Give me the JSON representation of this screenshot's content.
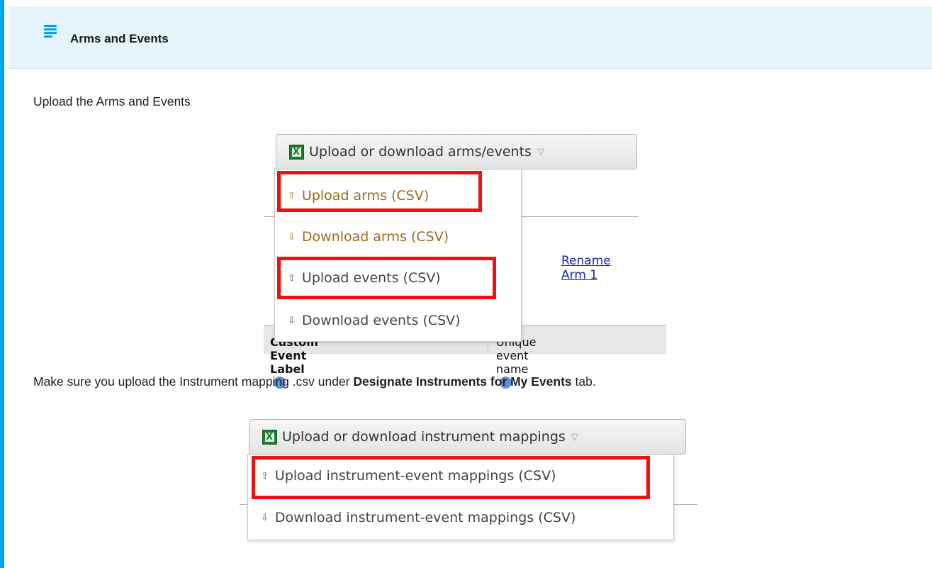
{
  "admonition": {
    "title": "Arms and Events",
    "icon": "list-icon",
    "accent_color": "#00a6e6"
  },
  "paragraph1": "Upload the Arms and Events",
  "paragraph2": {
    "before": "Make sure you upload the Instrument mapping .csv under ",
    "bold": "Designate Instruments for My Events",
    "after": " tab."
  },
  "screenshot1": {
    "button_label": "Upload or download arms/events",
    "items": [
      {
        "label": "Upload arms (CSV)",
        "icon": "up-arrow-icon",
        "highlighted": true
      },
      {
        "label": "Download arms (CSV)",
        "icon": "down-arrow-icon",
        "highlighted": false
      },
      {
        "label": "Upload events (CSV)",
        "icon": "up-arrow-icon",
        "highlighted": true
      },
      {
        "label": "Download events (CSV)",
        "icon": "down-arrow-icon",
        "highlighted": false
      }
    ],
    "link": "Rename Arm 1",
    "column1": "Custom Event Label",
    "column2": "Unique event name"
  },
  "screenshot2": {
    "button_label": "Upload or download instrument mappings",
    "items": [
      {
        "label": "Upload instrument-event mappings (CSV)",
        "icon": "up-arrow-icon",
        "highlighted": true
      },
      {
        "label": "Download instrument-event mappings (CSV)",
        "icon": "down-arrow-icon",
        "highlighted": false
      }
    ]
  },
  "highlight_color": "#ee1111"
}
